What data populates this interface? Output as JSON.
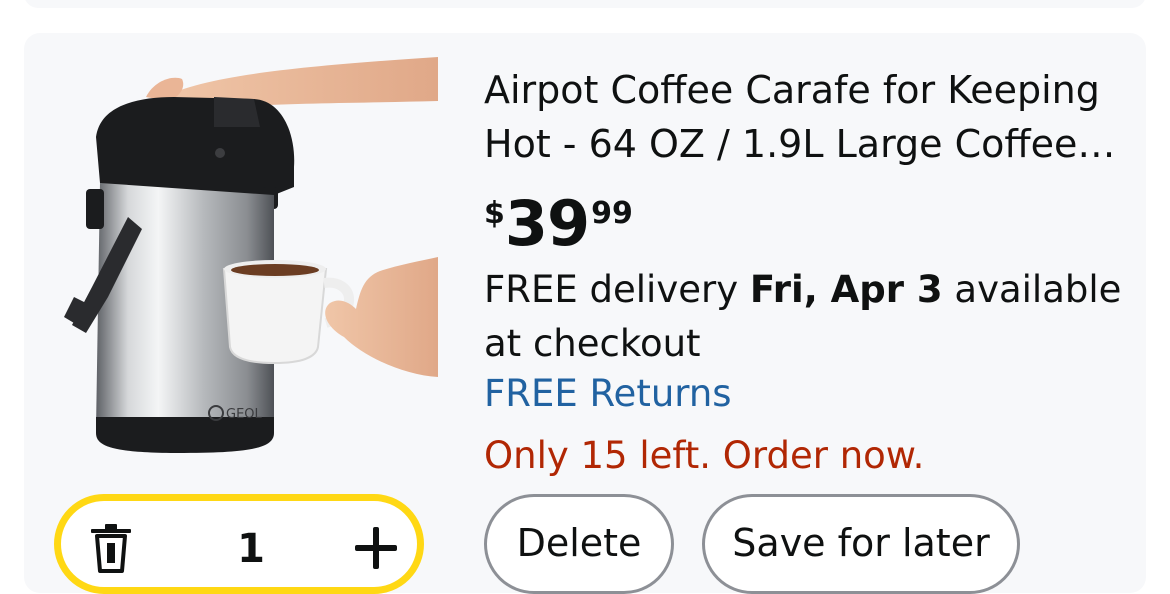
{
  "product": {
    "title": "Airpot Coffee Carafe for Keeping Hot - 64 OZ / 1.9L Large Coffee Dispenser",
    "price": {
      "symbol": "$",
      "whole": "39",
      "fraction": "99"
    },
    "delivery": {
      "prefix": "FREE delivery ",
      "date": "Fri, Apr 3",
      "suffix": " available at checkout"
    },
    "returns": "FREE Returns",
    "stock": "Only 15 left. Order now.",
    "image_brand": "GEOL",
    "image_icon": "coffee-airpot-image"
  },
  "quantity": {
    "value": "1",
    "decrement_icon": "trash-icon",
    "increment_icon": "plus-icon"
  },
  "actions": {
    "delete_label": "Delete",
    "save_label": "Save for later"
  },
  "colors": {
    "card_bg": "#f7f8fa",
    "returns_link": "#2162a1",
    "stock_warning": "#b12704",
    "qty_border": "#ffd814",
    "pill_border": "#8d9096"
  }
}
